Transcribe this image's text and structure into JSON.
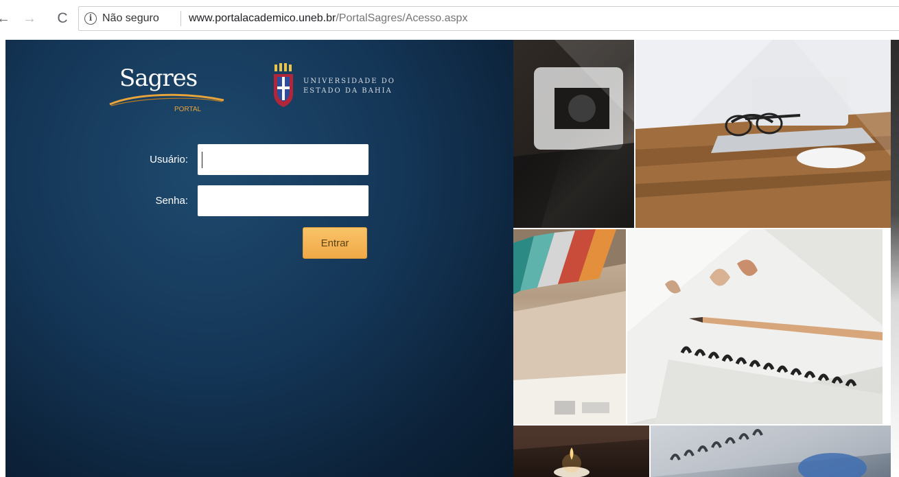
{
  "browser": {
    "back_glyph": "←",
    "forward_glyph": "→",
    "reload_glyph": "C",
    "info_glyph": "i",
    "security_label": "Não seguro",
    "url_host": "www.portalacademico.uneb.br",
    "url_path": "/PortalSagres/Acesso.aspx"
  },
  "branding": {
    "sagres_name": "Sagres",
    "sagres_subtitle": "PORTAL",
    "university_line1": "UNIVERSIDADE DO",
    "university_line2": "ESTADO DA BAHIA"
  },
  "login_form": {
    "username_label": "Usuário:",
    "username_value": "",
    "password_label": "Senha:",
    "password_value": "",
    "submit_label": "Entrar"
  },
  "colors": {
    "panel_blue": "#143657",
    "button_orange": "#f1a947",
    "logo_gold": "#e8a43a"
  },
  "icons": {
    "back": "back-arrow-icon",
    "forward": "forward-arrow-icon",
    "reload": "reload-icon",
    "info": "info-circle-icon"
  }
}
